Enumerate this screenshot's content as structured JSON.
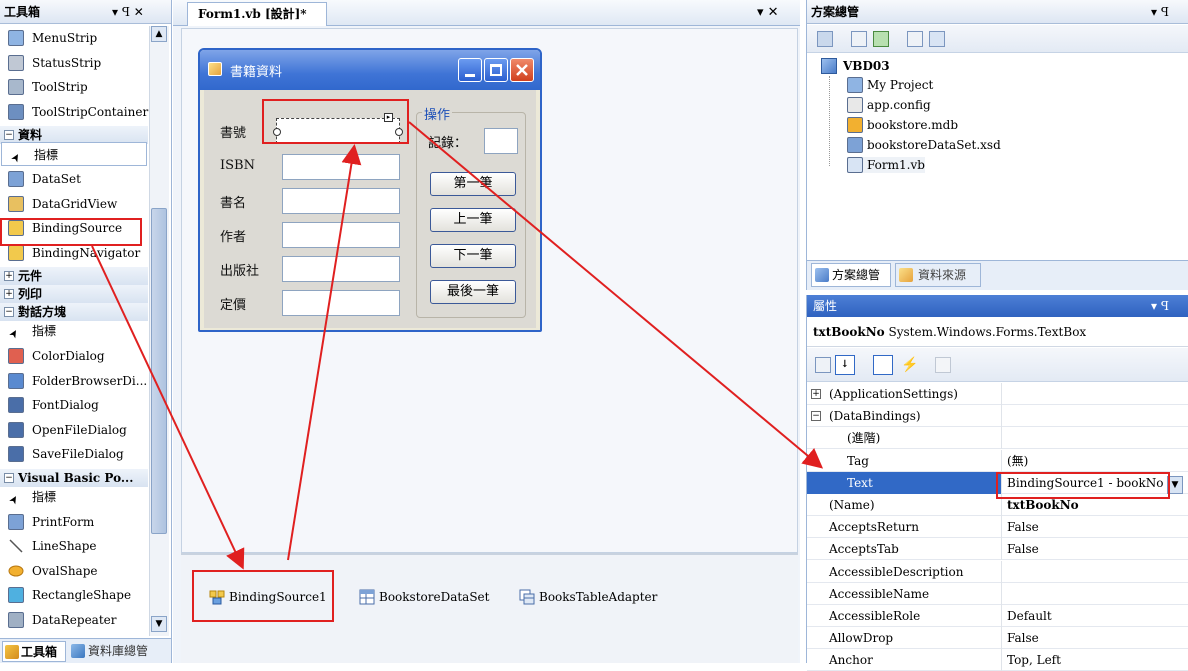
{
  "toolbox": {
    "title": "工具箱",
    "pin": "▾ ꟼ ✕",
    "items": [
      {
        "type": "item",
        "label": "MenuStrip",
        "icon": "menustrip-icon"
      },
      {
        "type": "item",
        "label": "StatusStrip",
        "icon": "statusstrip-icon"
      },
      {
        "type": "item",
        "label": "ToolStrip",
        "icon": "toolstrip-icon"
      },
      {
        "type": "item",
        "label": "ToolStripContainer",
        "icon": "toolstripcontainer-icon"
      },
      {
        "type": "cat",
        "label": "資料",
        "sign": "−"
      },
      {
        "type": "item",
        "label": "指標",
        "icon": "pointer-icon"
      },
      {
        "type": "item",
        "label": "DataSet",
        "icon": "dataset-icon"
      },
      {
        "type": "item",
        "label": "DataGridView",
        "icon": "datagridview-icon"
      },
      {
        "type": "item",
        "label": "BindingSource",
        "icon": "bindingsource-icon"
      },
      {
        "type": "item",
        "label": "BindingNavigator",
        "icon": "bindingnavigator-icon"
      },
      {
        "type": "cat",
        "label": "元件",
        "sign": "+"
      },
      {
        "type": "cat",
        "label": "列印",
        "sign": "+"
      },
      {
        "type": "cat",
        "label": "對話方塊",
        "sign": "−"
      },
      {
        "type": "item",
        "label": "指標",
        "icon": "pointer-icon"
      },
      {
        "type": "item",
        "label": "ColorDialog",
        "icon": "colordialog-icon"
      },
      {
        "type": "item",
        "label": "FolderBrowserDi...",
        "icon": "folderbrowser-icon"
      },
      {
        "type": "item",
        "label": "FontDialog",
        "icon": "fontdialog-icon"
      },
      {
        "type": "item",
        "label": "OpenFileDialog",
        "icon": "openfile-icon"
      },
      {
        "type": "item",
        "label": "SaveFileDialog",
        "icon": "savefile-icon"
      },
      {
        "type": "cat",
        "label": "Visual Basic Po...",
        "sign": "−"
      },
      {
        "type": "item",
        "label": "指標",
        "icon": "pointer-icon"
      },
      {
        "type": "item",
        "label": "PrintForm",
        "icon": "printform-icon"
      },
      {
        "type": "item",
        "label": "LineShape",
        "icon": "lineshape-icon"
      },
      {
        "type": "item",
        "label": "OvalShape",
        "icon": "ovalshape-icon"
      },
      {
        "type": "item",
        "label": "RectangleShape",
        "icon": "rectangleshape-icon"
      },
      {
        "type": "item",
        "label": "DataRepeater",
        "icon": "datarepeater-icon"
      }
    ],
    "tabs": [
      "工具箱",
      "資料庫總管"
    ]
  },
  "designer": {
    "tab_label": "Form1.vb [設計]*",
    "tab_controls": "▾ ✕",
    "form": {
      "title": "書籍資料",
      "labels": [
        "書號",
        "ISBN",
        "書名",
        "作者",
        "出版社",
        "定價"
      ],
      "group_title": "操作",
      "record_label": "記錄：",
      "buttons": [
        "第一筆",
        "上一筆",
        "下一筆",
        "最後一筆"
      ]
    },
    "tray": [
      "BindingSource1",
      "BookstoreDataSet",
      "BooksTableAdapter"
    ]
  },
  "solution_explorer": {
    "title": "方案總管",
    "pin": "▾ ꟼ",
    "project": "VBD03",
    "files": [
      "My Project",
      "app.config",
      "bookstore.mdb",
      "bookstoreDataSet.xsd",
      "Form1.vb"
    ],
    "tabs": [
      "方案總管",
      "資料來源"
    ]
  },
  "properties": {
    "title": "屬性",
    "pin": "▾ ꟼ",
    "object_name": "txtBookNo",
    "object_type": "System.Windows.Forms.TextBox",
    "rows": [
      {
        "expander": "+",
        "name": "(ApplicationSettings)",
        "value": "",
        "indent": 0,
        "bold": false
      },
      {
        "expander": "−",
        "name": "(DataBindings)",
        "value": "",
        "indent": 0,
        "bold": false
      },
      {
        "expander": "",
        "name": "(進階)",
        "value": "",
        "indent": 1,
        "bold": false
      },
      {
        "expander": "",
        "name": "Tag",
        "value": "(無)",
        "indent": 1,
        "bold": false
      },
      {
        "expander": "",
        "name": "Text",
        "value": "BindingSource1 - bookNo",
        "indent": 1,
        "bold": false,
        "selected": true
      },
      {
        "expander": "",
        "name": "(Name)",
        "value": "txtBookNo",
        "indent": 0,
        "bold": true
      },
      {
        "expander": "",
        "name": "AcceptsReturn",
        "value": "False",
        "indent": 0,
        "bold": false
      },
      {
        "expander": "",
        "name": "AcceptsTab",
        "value": "False",
        "indent": 0,
        "bold": false
      },
      {
        "expander": "",
        "name": "AccessibleDescription",
        "value": "",
        "indent": 0,
        "bold": false
      },
      {
        "expander": "",
        "name": "AccessibleName",
        "value": "",
        "indent": 0,
        "bold": false
      },
      {
        "expander": "",
        "name": "AccessibleRole",
        "value": "Default",
        "indent": 0,
        "bold": false
      },
      {
        "expander": "",
        "name": "AllowDrop",
        "value": "False",
        "indent": 0,
        "bold": false
      },
      {
        "expander": "",
        "name": "Anchor",
        "value": "Top, Left",
        "indent": 0,
        "bold": false
      }
    ]
  },
  "colors": {
    "accent": "#2e64c8",
    "highlight": "#e02020",
    "selection": "#3169c6"
  }
}
